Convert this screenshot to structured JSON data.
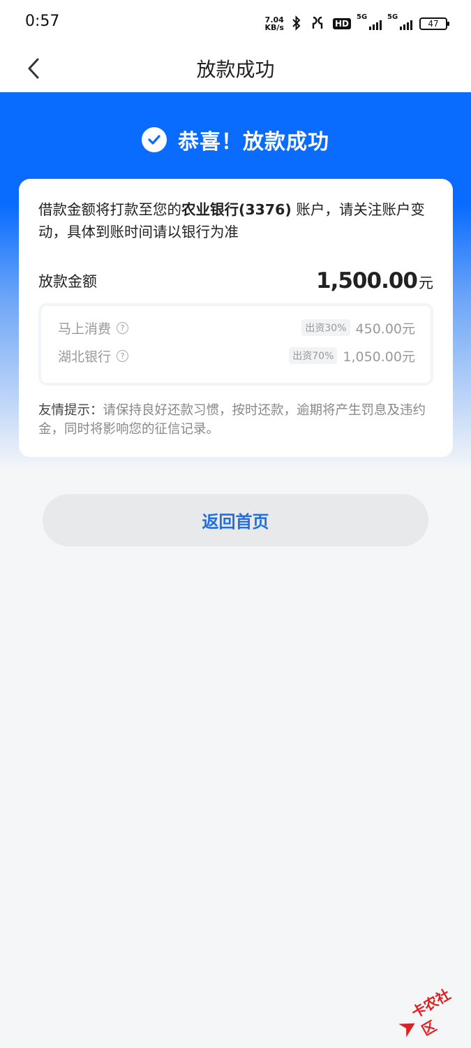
{
  "status_bar": {
    "time": "0:57",
    "net_speed_value": "7.04",
    "net_speed_unit": "KB/s",
    "hd_label": "HD",
    "signal_1_label": "5G",
    "signal_2_label": "5G",
    "battery": "47"
  },
  "nav": {
    "title": "放款成功"
  },
  "hero": {
    "title": "恭喜！放款成功"
  },
  "card": {
    "notice_prefix": "借款金额将打款至您的",
    "notice_bank": "农业银行(3376)",
    "notice_suffix": " 账户，请关注账户变动，具体到账时间请以银行为准",
    "amount_label": "放款金额",
    "amount_value": "1,500.00",
    "amount_unit": "元",
    "funders": [
      {
        "name": "马上消费",
        "share": "出资30%",
        "amount": "450.00元"
      },
      {
        "name": "湖北银行",
        "share": "出资70%",
        "amount": "1,050.00元"
      }
    ],
    "question_mark": "?",
    "tip_label": "友情提示：",
    "tip_text": "请保持良好还款习惯，按时还款，逾期将产生罚息及违约金，同时将影响您的征信记录。"
  },
  "actions": {
    "home_button": "返回首页"
  },
  "watermark": {
    "text": "卡农社区"
  },
  "colors": {
    "brand_blue": "#0a6cff",
    "button_text": "#1f6fe0",
    "watermark_red": "#e02020"
  }
}
